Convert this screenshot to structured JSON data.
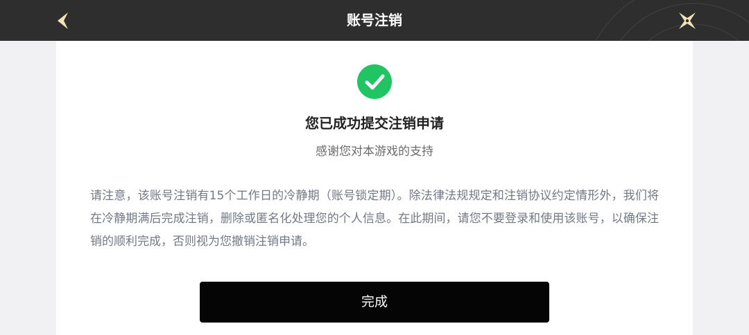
{
  "header": {
    "title": "账号注销",
    "back_icon": "chevron-left-icon",
    "close_icon": "close-icon",
    "background_color": "#2e2e2e",
    "accent_color": "#f2e2b8"
  },
  "content": {
    "status_icon": "check-circle-icon",
    "status_color": "#21c463",
    "headline": "您已成功提交注销申请",
    "subline": "感谢您对本游戏的支持",
    "notice": "请注意，该账号注销有15个工作日的冷静期（账号锁定期）。除法律法规规定和注销协议约定情形外，我们将在冷静期满后完成注销，删除或匿名化处理您的个人信息。在此期间，请您不要登录和使用该账号，以确保注销的顺利完成，否则视为您撤销注销申请。"
  },
  "footer": {
    "done_label": "完成",
    "button_color": "#050505"
  }
}
